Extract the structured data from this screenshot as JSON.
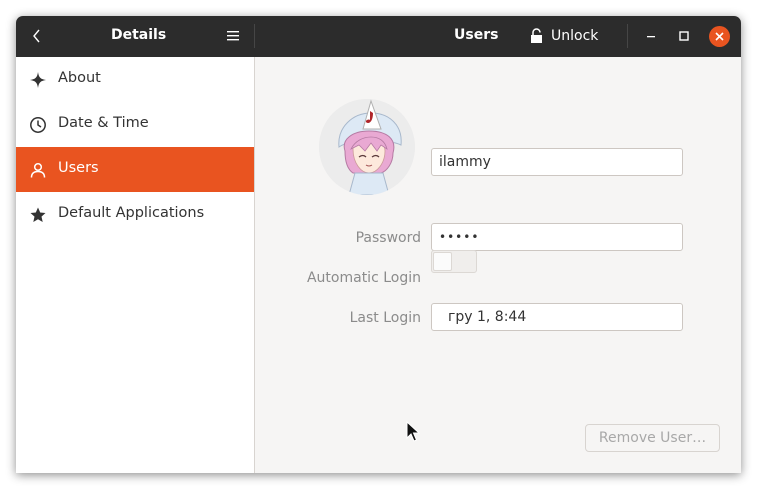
{
  "left_header": {
    "title": "Details",
    "back_icon": "chevron-left-icon",
    "menu_icon": "hamburger-menu-icon"
  },
  "right_header": {
    "title": "Users",
    "unlock_label": "Unlock",
    "lock_icon": "unlocked-padlock-icon"
  },
  "window_controls": [
    "minimize-icon",
    "maximize-icon",
    "close-icon"
  ],
  "sidebar": {
    "items": [
      {
        "label": "About",
        "icon": "sparkle-icon",
        "active": false
      },
      {
        "label": "Date & Time",
        "icon": "clock-icon",
        "active": false
      },
      {
        "label": "Users",
        "icon": "person-icon",
        "active": true
      },
      {
        "label": "Default Applications",
        "icon": "star-icon",
        "active": false
      }
    ]
  },
  "user": {
    "avatar": "anime-character-avatar",
    "name": "ilammy",
    "password_label": "Password",
    "password_value": "•••••",
    "auto_login_label": "Automatic Login",
    "auto_login": false,
    "last_login_label": "Last Login",
    "last_login_value": "гру 1, 8:44"
  },
  "remove_button_label": "Remove User…",
  "colors": {
    "accent": "#e95420",
    "headerbar": "#2c2c2c",
    "sidebar_bg": "#ffffff",
    "content_bg": "#f6f5f4"
  }
}
